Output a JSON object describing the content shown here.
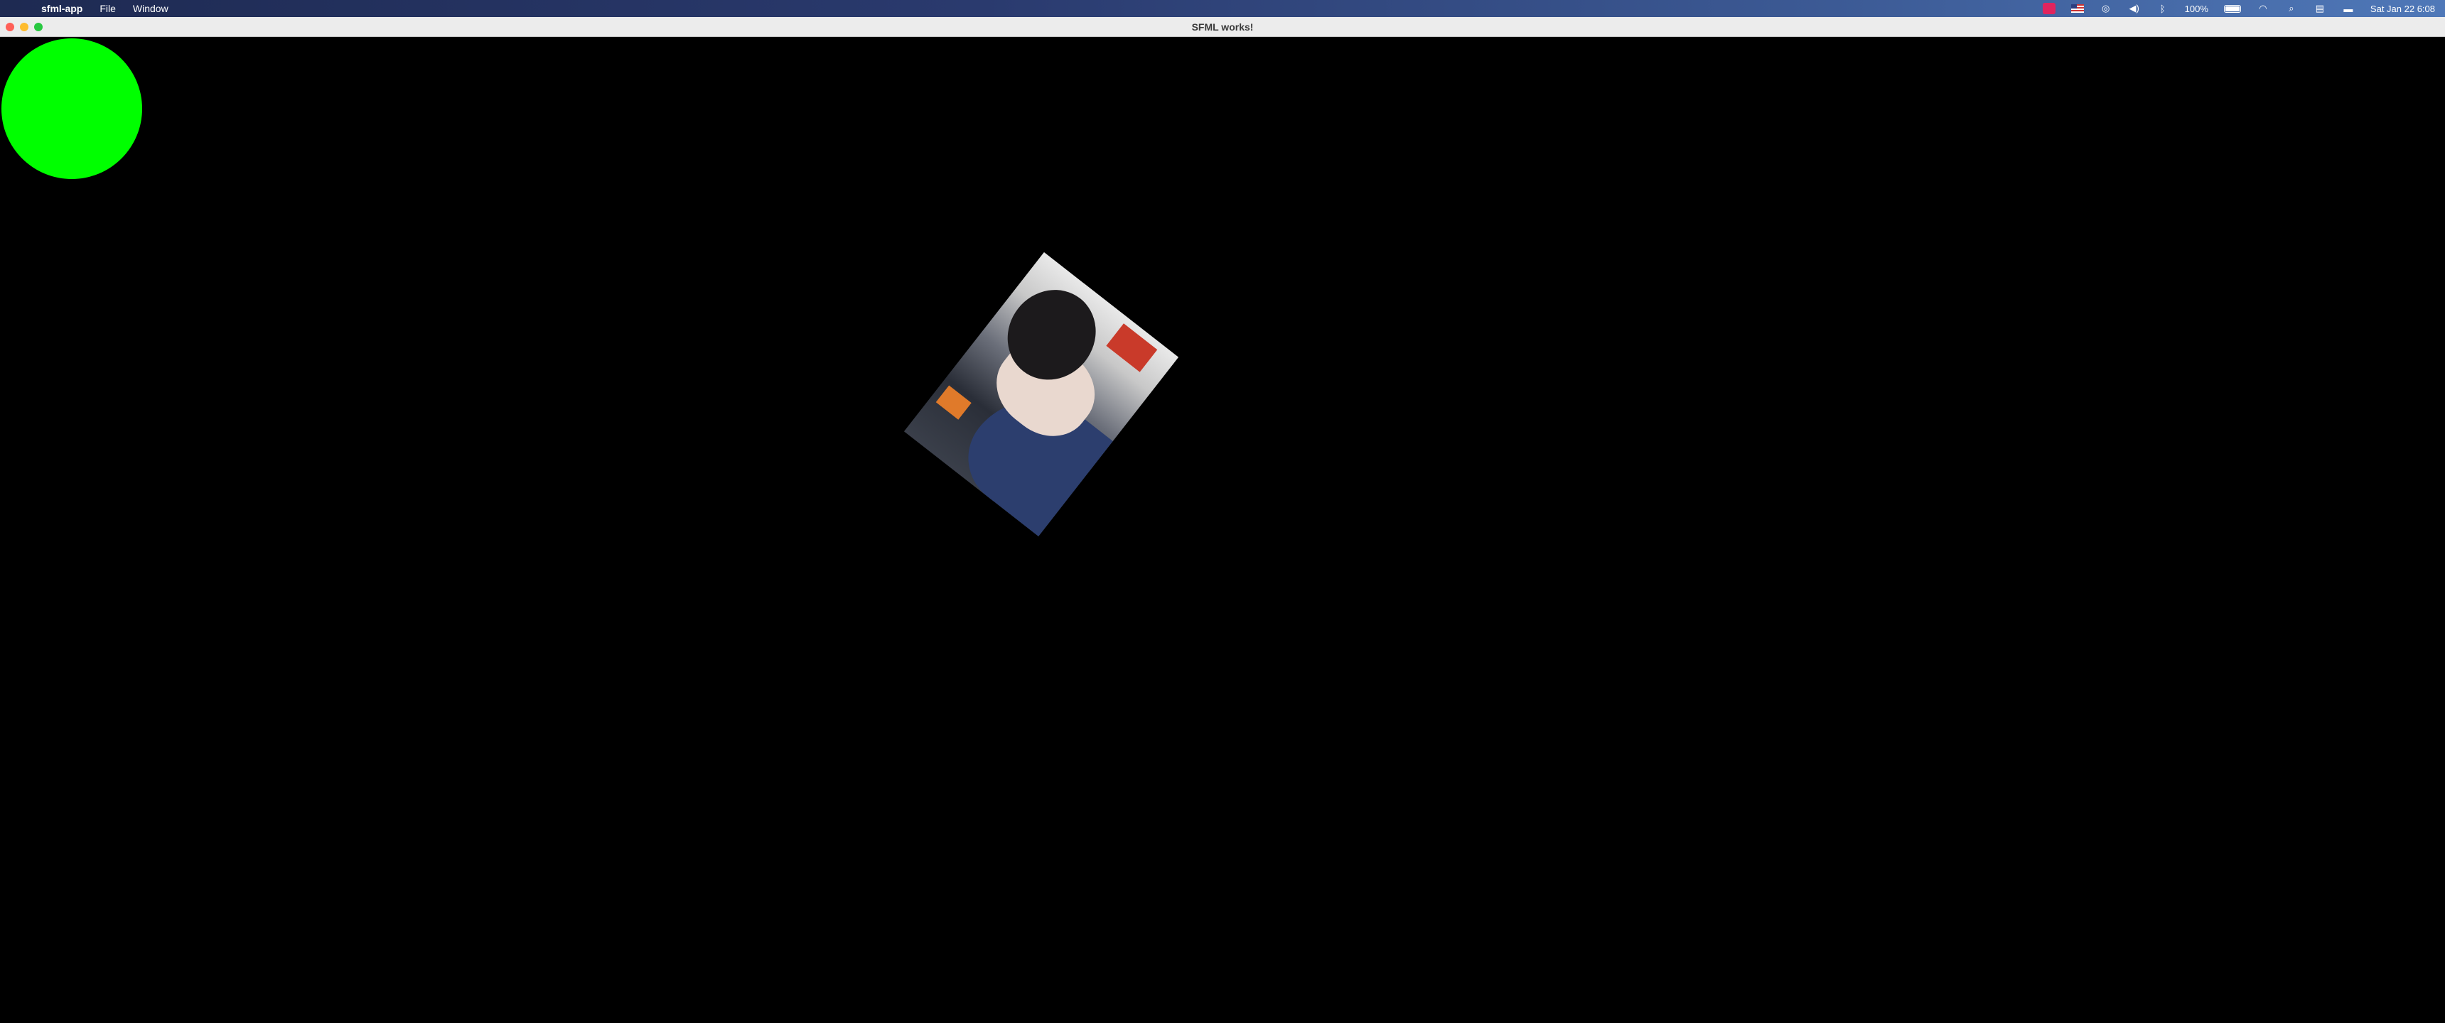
{
  "menubar": {
    "apple_icon": "apple-icon",
    "app_name": "sfml-app",
    "menus": [
      "File",
      "Window"
    ],
    "status": {
      "battery_percent": "100%",
      "datetime": "Sat Jan 22  6:08"
    }
  },
  "window": {
    "title": "SFML works!"
  },
  "canvas": {
    "background": "#000000",
    "shapes": {
      "circle_color": "#00ff00",
      "sprite_rotation_deg": -52
    }
  }
}
